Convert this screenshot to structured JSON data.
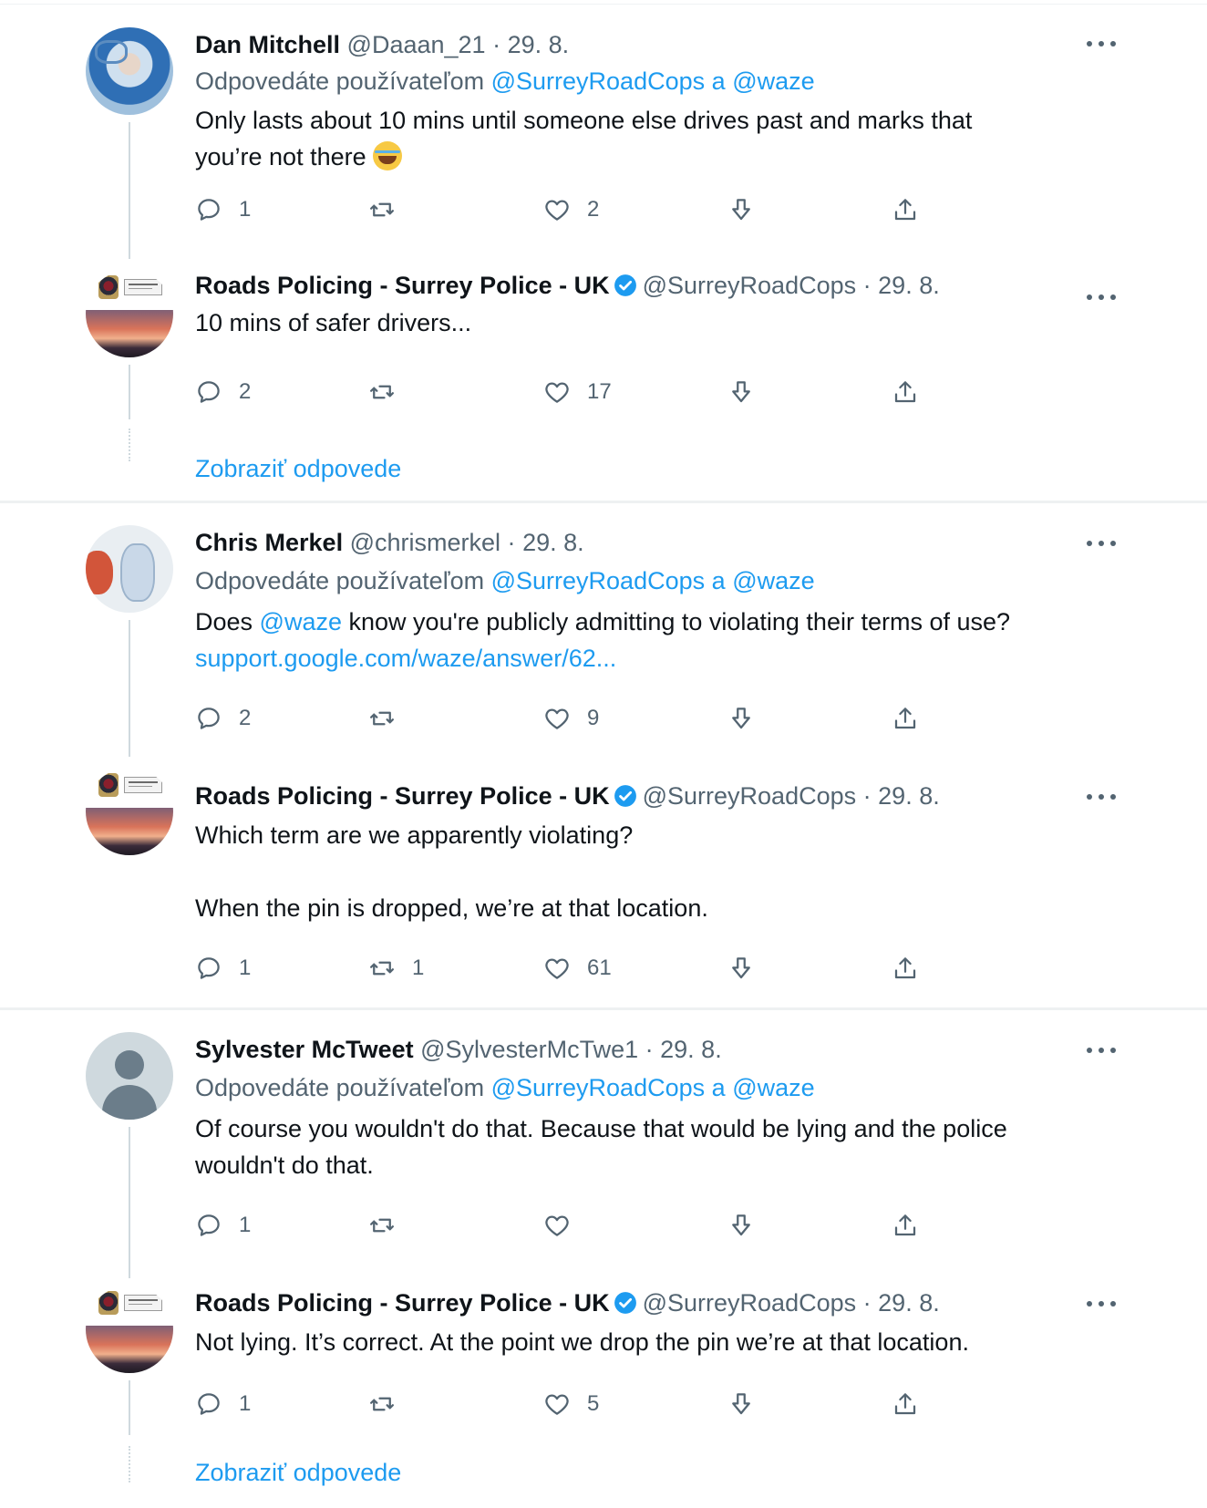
{
  "tweets": [
    {
      "name": "Dan Mitchell",
      "handle": "@Daaan_21",
      "sep": "·",
      "date": "29. 8.",
      "replying_prefix": "Odpovedáte používateľom",
      "replying_user1": "@SurreyRoadCops",
      "replying_and": "a",
      "replying_user2": "@waze",
      "text_line1": "Only lasts about 10 mins until someone else drives past and marks that",
      "text_line2": "you’re not there",
      "emoji": "tears-of-joy-emoji",
      "replies": "1",
      "retweets": "",
      "likes": "2"
    },
    {
      "name": "Roads Policing - Surrey Police - UK",
      "handle": "@SurreyRoadCops",
      "sep": "·",
      "date": "29. 8.",
      "text_line1": "10 mins of safer drivers...",
      "replies": "2",
      "retweets": "",
      "likes": "17",
      "show_replies": "Zobraziť odpovede"
    },
    {
      "name": "Chris Merkel",
      "handle": "@chrismerkel",
      "sep": "·",
      "date": "29. 8.",
      "replying_prefix": "Odpovedáte používateľom",
      "replying_user1": "@SurreyRoadCops",
      "replying_and": "a",
      "replying_user2": "@waze",
      "text_pre": "Does",
      "text_mention": "@waze",
      "text_post": "know you're publicly admitting to violating their terms of use?",
      "text_link": "support.google.com/waze/answer/62...",
      "replies": "2",
      "retweets": "",
      "likes": "9"
    },
    {
      "name": "Roads Policing - Surrey Police - UK",
      "handle": "@SurreyRoadCops",
      "sep": "·",
      "date": "29. 8.",
      "text_line1": "Which term are we apparently violating?",
      "text_line2": "When the pin is dropped, we’re at that location.",
      "replies": "1",
      "retweets": "1",
      "likes": "61"
    },
    {
      "name": "Sylvester McTweet",
      "handle": "@SylvesterMcTwe1",
      "sep": "·",
      "date": "29. 8.",
      "replying_prefix": "Odpovedáte používateľom",
      "replying_user1": "@SurreyRoadCops",
      "replying_and": "a",
      "replying_user2": "@waze",
      "text_line1": "Of course you wouldn't do that. Because that would be lying and the police",
      "text_line2": "wouldn't do that.",
      "replies": "1",
      "retweets": "",
      "likes": ""
    },
    {
      "name": "Roads Policing - Surrey Police - UK",
      "handle": "@SurreyRoadCops",
      "sep": "·",
      "date": "29. 8.",
      "text_line1": "Not lying. It’s correct. At the point we drop the pin we’re at that location.",
      "replies": "1",
      "retweets": "",
      "likes": "5",
      "show_replies": "Zobraziť odpovede"
    }
  ],
  "colors": {
    "text": "#0f1419",
    "secondary": "#536471",
    "link": "#1d9bf0",
    "verified": "#1d9bf0",
    "thread_line": "#cfd9de"
  }
}
